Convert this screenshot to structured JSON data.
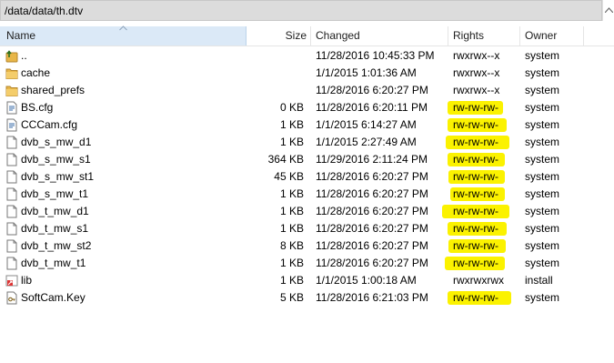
{
  "path": "/data/data/th.dtv",
  "columns": {
    "name": "Name",
    "size": "Size",
    "changed": "Changed",
    "rights": "Rights",
    "owner": "Owner"
  },
  "files": [
    {
      "name": "..",
      "icon": "parent-folder-icon",
      "size": "",
      "changed": "11/28/2016 10:45:33 PM",
      "rights": "rwxrwx--x",
      "owner": "system",
      "highlighted": false
    },
    {
      "name": "cache",
      "icon": "folder-icon",
      "size": "",
      "changed": "1/1/2015 1:01:36 AM",
      "rights": "rwxrwx--x",
      "owner": "system",
      "highlighted": false
    },
    {
      "name": "shared_prefs",
      "icon": "folder-icon",
      "size": "",
      "changed": "11/28/2016 6:20:27 PM",
      "rights": "rwxrwx--x",
      "owner": "system",
      "highlighted": false
    },
    {
      "name": "BS.cfg",
      "icon": "config-file-icon",
      "size": "0 KB",
      "changed": "11/28/2016 6:20:11 PM",
      "rights": "rw-rw-rw-",
      "owner": "system",
      "highlighted": true
    },
    {
      "name": "CCCam.cfg",
      "icon": "config-file-icon",
      "size": "1 KB",
      "changed": "1/1/2015 6:14:27 AM",
      "rights": "rw-rw-rw-",
      "owner": "system",
      "highlighted": true
    },
    {
      "name": "dvb_s_mw_d1",
      "icon": "file-icon",
      "size": "1 KB",
      "changed": "1/1/2015 2:27:49 AM",
      "rights": "rw-rw-rw-",
      "owner": "system",
      "highlighted": true
    },
    {
      "name": "dvb_s_mw_s1",
      "icon": "file-icon",
      "size": "364 KB",
      "changed": "11/29/2016 2:11:24 PM",
      "rights": "rw-rw-rw-",
      "owner": "system",
      "highlighted": true
    },
    {
      "name": "dvb_s_mw_st1",
      "icon": "file-icon",
      "size": "45 KB",
      "changed": "11/28/2016 6:20:27 PM",
      "rights": "rw-rw-rw-",
      "owner": "system",
      "highlighted": true
    },
    {
      "name": "dvb_s_mw_t1",
      "icon": "file-icon",
      "size": "1 KB",
      "changed": "11/28/2016 6:20:27 PM",
      "rights": "rw-rw-rw-",
      "owner": "system",
      "highlighted": true
    },
    {
      "name": "dvb_t_mw_d1",
      "icon": "file-icon",
      "size": "1 KB",
      "changed": "11/28/2016 6:20:27 PM",
      "rights": "rw-rw-rw-",
      "owner": "system",
      "highlighted": true
    },
    {
      "name": "dvb_t_mw_s1",
      "icon": "file-icon",
      "size": "1 KB",
      "changed": "11/28/2016 6:20:27 PM",
      "rights": "rw-rw-rw-",
      "owner": "system",
      "highlighted": true
    },
    {
      "name": "dvb_t_mw_st2",
      "icon": "file-icon",
      "size": "8 KB",
      "changed": "11/28/2016 6:20:27 PM",
      "rights": "rw-rw-rw-",
      "owner": "system",
      "highlighted": true
    },
    {
      "name": "dvb_t_mw_t1",
      "icon": "file-icon",
      "size": "1 KB",
      "changed": "11/28/2016 6:20:27 PM",
      "rights": "rw-rw-rw-",
      "owner": "system",
      "highlighted": true
    },
    {
      "name": "lib",
      "icon": "symlink-icon",
      "size": "1 KB",
      "changed": "1/1/2015 1:00:18 AM",
      "rights": "rwxrwxrwx",
      "owner": "install",
      "highlighted": false
    },
    {
      "name": "SoftCam.Key",
      "icon": "key-file-icon",
      "size": "5 KB",
      "changed": "11/28/2016 6:21:03 PM",
      "rights": "rw-rw-rw-",
      "owner": "system",
      "highlighted": true
    }
  ],
  "colors": {
    "highlight": "#fbf200",
    "selected_header": "#dbe9f7",
    "folder": "#e8b648"
  }
}
